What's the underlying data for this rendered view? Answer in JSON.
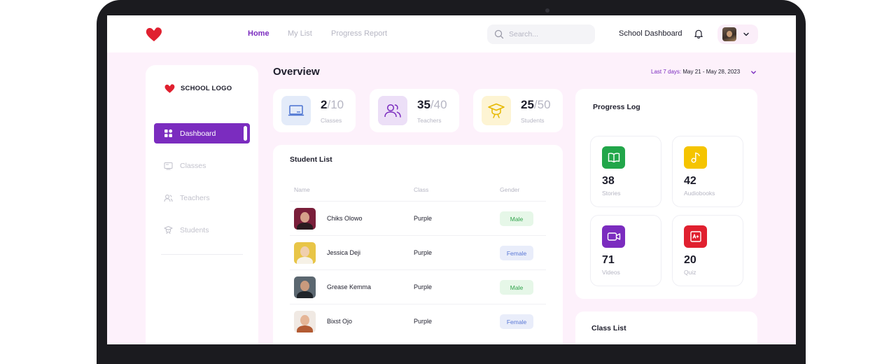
{
  "nav": {
    "links": [
      "Home",
      "My List",
      "Progress Report"
    ],
    "search_placeholder": "Search...",
    "dashboard_title": "School Dashboard"
  },
  "sidebar": {
    "logo_text": "SCHOOL LOGO",
    "items": [
      {
        "label": "Dashboard",
        "icon": "dashboard-icon",
        "active": true
      },
      {
        "label": "Classes",
        "icon": "classes-icon",
        "active": false
      },
      {
        "label": "Teachers",
        "icon": "teachers-icon",
        "active": false
      },
      {
        "label": "Students",
        "icon": "students-icon",
        "active": false
      }
    ]
  },
  "overview": {
    "title": "Overview",
    "date_label": "Last 7 days:",
    "date_range": "May 21 - May 28, 2023",
    "stats": [
      {
        "value": "2",
        "total": "/10",
        "label": "Classes",
        "icon": "blackboard-icon"
      },
      {
        "value": "35",
        "total": "/40",
        "label": "Teachers",
        "icon": "users-icon"
      },
      {
        "value": "25",
        "total": "/50",
        "label": "Students",
        "icon": "graduation-cap-icon"
      }
    ]
  },
  "student_list": {
    "title": "Student List",
    "headers": [
      "Name",
      "Class",
      "Gender"
    ],
    "rows": [
      {
        "name": "Chiks Olowo",
        "class": "Purple",
        "gender": "Male"
      },
      {
        "name": "Jessica Deji",
        "class": "Purple",
        "gender": "Female"
      },
      {
        "name": "Grease Kemma",
        "class": "Purple",
        "gender": "Male"
      },
      {
        "name": "Bixst Ojo",
        "class": "Purple",
        "gender": "Female"
      }
    ]
  },
  "progress_log": {
    "title": "Progress Log",
    "tiles": [
      {
        "value": "38",
        "label": "Stories",
        "icon": "book-icon",
        "color": "#22a64a"
      },
      {
        "value": "42",
        "label": "Audiobooks",
        "icon": "music-note-icon",
        "color": "#f5c400"
      },
      {
        "value": "71",
        "label": "Videos",
        "icon": "video-icon",
        "color": "#7b2cbf"
      },
      {
        "value": "20",
        "label": "Quiz",
        "icon": "quiz-icon",
        "color": "#e0202f"
      }
    ]
  },
  "class_list": {
    "title": "Class List"
  },
  "colors": {
    "accent": "#7b2cbf",
    "background": "#fdf1fb",
    "logo_red": "#e0202f"
  }
}
